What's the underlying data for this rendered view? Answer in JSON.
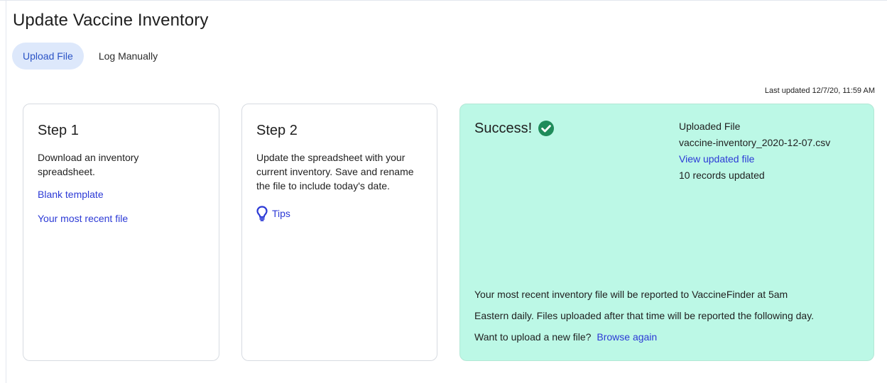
{
  "page": {
    "title": "Update Vaccine Inventory"
  },
  "tabs": [
    {
      "label": "Upload File",
      "active": true
    },
    {
      "label": "Log Manually",
      "active": false
    }
  ],
  "last_updated": "Last updated 12/7/20, 11:59 AM",
  "step1": {
    "title": "Step 1",
    "text": "Download an inventory spreadsheet.",
    "links": [
      "Blank template",
      "Your most recent file"
    ]
  },
  "step2": {
    "title": "Step 2",
    "text": "Update the spreadsheet with your current inventory. Save and rename the file to include today's date.",
    "tips_label": "Tips",
    "tips_icon": "lightbulb-icon"
  },
  "success": {
    "title": "Success!",
    "icon": "check-circle-icon",
    "uploaded_label": "Uploaded File",
    "file_name": "vaccine-inventory_2020-12-07.csv",
    "view_link": "View updated file",
    "records": "10 records updated",
    "report_line1": "Your most recent inventory file will be reported to VaccineFinder at 5am",
    "report_line2": "Eastern daily. Files uploaded after that time will be reported the following day.",
    "upload_prompt": "Want to upload a new file?",
    "browse_link": "Browse again"
  },
  "colors": {
    "link": "#2c3ad6",
    "active_tab_bg": "#dde8fb",
    "success_bg": "#bcf8e6",
    "check": "#1f8b5a"
  }
}
